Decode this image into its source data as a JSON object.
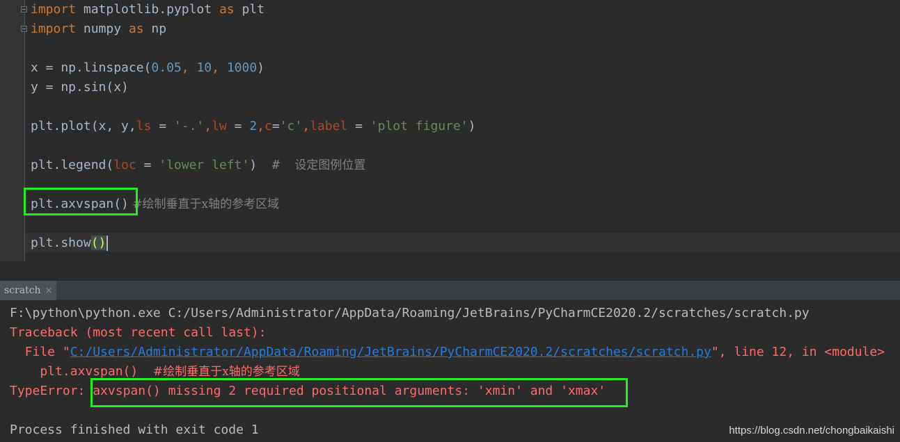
{
  "editor": {
    "lines": {
      "l1": {
        "kw_import": "import",
        "module": " matplotlib.pyplot ",
        "kw_as": "as",
        "alias": " plt"
      },
      "l2": {
        "kw_import": "import",
        "module": " numpy ",
        "kw_as": "as",
        "alias": " np"
      },
      "l4": {
        "pre": "x = np.linspace(",
        "n1": "0.05",
        "sep1": ", ",
        "n2": "10",
        "sep2": ", ",
        "n3": "1000",
        "post": ")"
      },
      "l5": {
        "text": "y = np.sin(x)"
      },
      "l7": {
        "pre": "plt.plot(x, y,",
        "p1": "ls",
        "eq1": " = ",
        "s1": "'-.'",
        "c1": ",",
        "p2": "lw",
        "eq2": " = ",
        "n1": "2",
        "c2": ",",
        "p3": "c",
        "eq3": "=",
        "s2": "'c'",
        "c3": ",",
        "p4": "label",
        "eq4": " = ",
        "s3": "'plot figure'",
        "post": ")"
      },
      "l9": {
        "pre": "plt.legend(",
        "p1": "loc",
        "eq1": " = ",
        "s1": "'lower left'",
        "post": ")  ",
        "hash": "#  ",
        "comment": "设定图例位置"
      },
      "l11": {
        "code": "plt.axvspan()",
        "comment": " #绘制垂直于x轴的参考区域"
      },
      "l13": {
        "pre": "plt.show",
        "paren": "()"
      }
    }
  },
  "run_panel": {
    "tab_label": "scratch",
    "tab_close": "×"
  },
  "console": {
    "cmd": "F:\\python\\python.exe C:/Users/Administrator/AppData/Roaming/JetBrains/PyCharmCE2020.2/scratches/scratch.py",
    "traceback": "Traceback (most recent call last):",
    "file_pre": "  File \"",
    "file_link": "C:/Users/Administrator/AppData/Roaming/JetBrains/PyCharmCE2020.2/scratches/scratch.py",
    "file_post": "\", line 12, in <module>",
    "src_code": "    plt.axvspan()  ",
    "src_comment": "#绘制垂直于x轴的参考区域",
    "err_type": "TypeError: ",
    "err_msg": "axvspan() missing 2 required positional arguments: 'xmin' and 'xmax'",
    "finished": "Process finished with exit code 1"
  },
  "watermark": "https://blog.csdn.net/chongbaikaishi",
  "colors": {
    "highlight_box": "#22ee22",
    "error_text": "#ff6b68",
    "link": "#287bde"
  }
}
